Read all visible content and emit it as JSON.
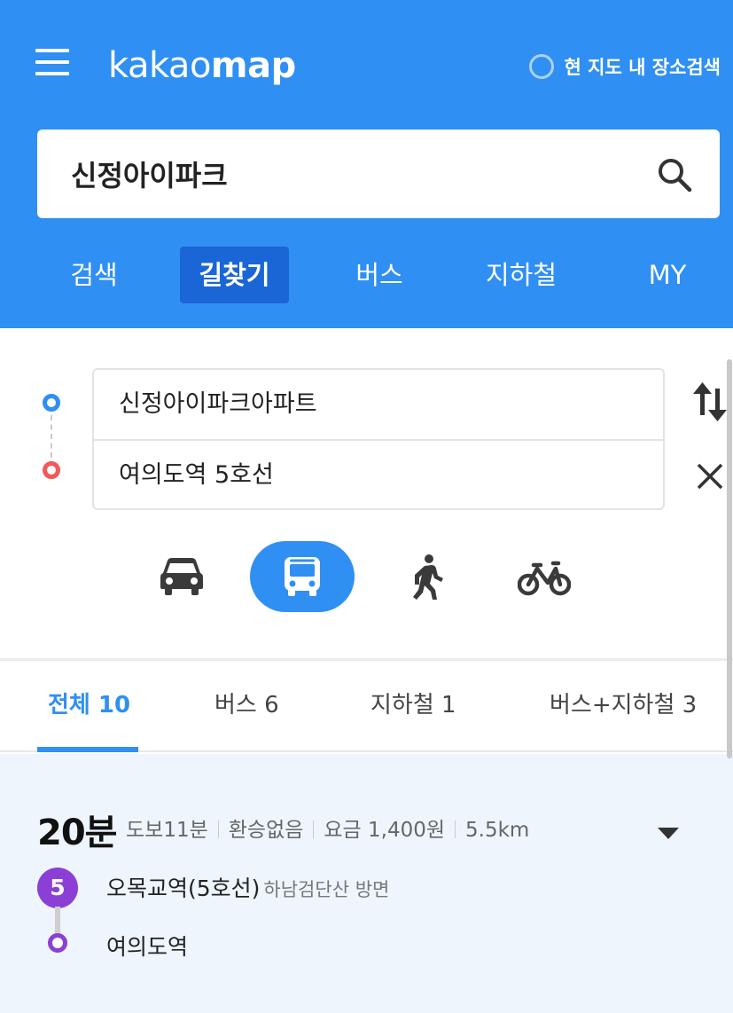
{
  "header": {
    "logo_light": "kakao",
    "logo_bold": "map",
    "map_search_label": "현 지도 내 장소검색",
    "search": {
      "value": "신정아이파크"
    },
    "nav": [
      {
        "label": "검색",
        "active": false
      },
      {
        "label": "길찾기",
        "active": true
      },
      {
        "label": "버스",
        "active": false
      },
      {
        "label": "지하철",
        "active": false
      },
      {
        "label": "MY",
        "active": false
      }
    ]
  },
  "route": {
    "origin": "신정아이파크아파트",
    "destination": "여의도역 5호선",
    "modes": [
      {
        "icon": "car-icon",
        "active": false
      },
      {
        "icon": "bus-icon",
        "active": true
      },
      {
        "icon": "walk-icon",
        "active": false
      },
      {
        "icon": "bike-icon",
        "active": false
      }
    ]
  },
  "tabs": [
    {
      "label": "전체 10",
      "active": true
    },
    {
      "label": "버스 6",
      "active": false
    },
    {
      "label": "지하철 1",
      "active": false
    },
    {
      "label": "버스+지하철 3",
      "active": false
    }
  ],
  "result": {
    "time": "20분",
    "walk": "도보11분",
    "transfer": "환승없음",
    "fare": "요금 1,400원",
    "distance": "5.5km",
    "line_number": "5",
    "line_color": "#8b3fd6",
    "board_station": "오목교역(5호선)",
    "direction": "하남검단산 방면",
    "alight_station": "여의도역"
  },
  "colors": {
    "brand": "#2f8ff3",
    "nav_active": "#1a66d6",
    "origin_dot": "#2f8ff3",
    "destination_dot": "#f25a5a",
    "result_bg": "#eef5fd"
  }
}
